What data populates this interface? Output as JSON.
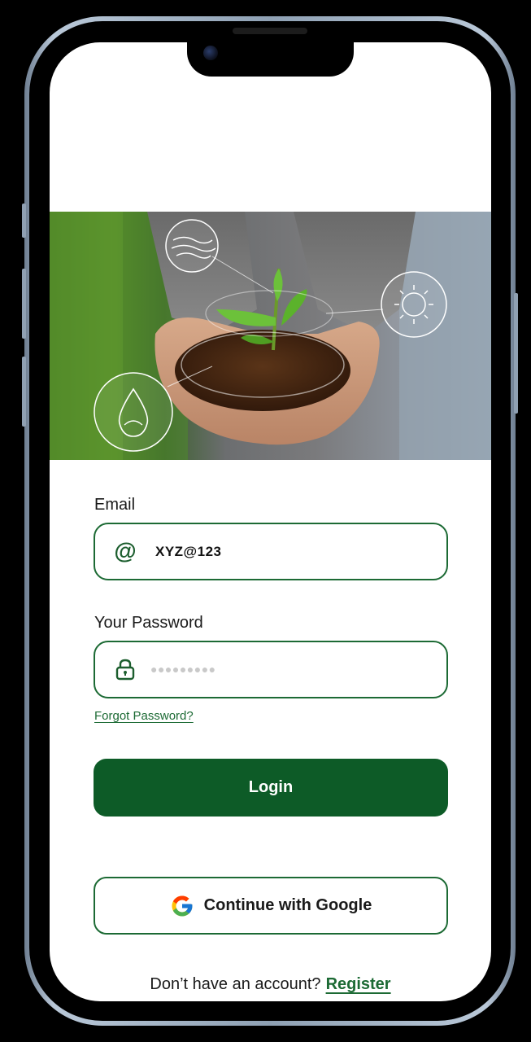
{
  "hero": {
    "icons": [
      "wind-icon",
      "water-drop-icon",
      "sun-icon"
    ]
  },
  "form": {
    "email_label": "Email",
    "email_value": "XYZ@123",
    "email_icon": "@",
    "password_label": "Your Password",
    "password_value": "●●●●●●●●●",
    "forgot_password": "Forgot Password?"
  },
  "actions": {
    "login_label": "Login",
    "google_label": "Continue with Google"
  },
  "footer": {
    "prompt": "Don’t have an account?",
    "register_label": "Register"
  },
  "colors": {
    "primary": "#0d5b27",
    "outline": "#1c6a34",
    "background": "#ffffff"
  }
}
